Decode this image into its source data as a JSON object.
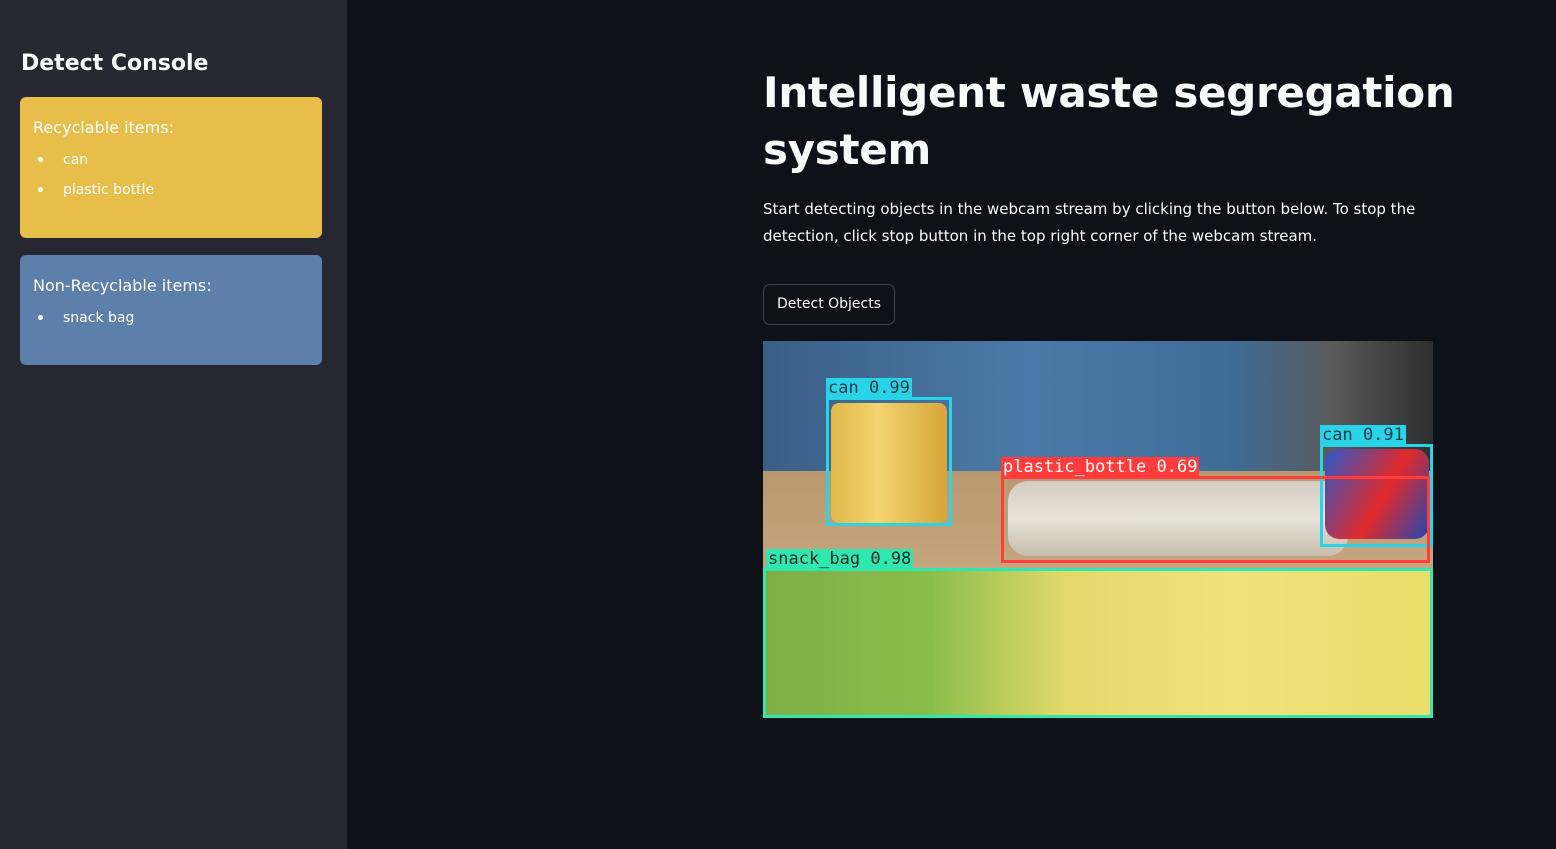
{
  "sidebar": {
    "title": "Detect Console",
    "recyclable": {
      "heading": "Recyclable items:",
      "items": [
        "can",
        "plastic bottle"
      ],
      "color": "#e8be4b"
    },
    "non_recyclable": {
      "heading": "Non-Recyclable items:",
      "items": [
        "snack bag"
      ],
      "color": "#5d7fac"
    }
  },
  "main": {
    "title": "Intelligent waste segregation system",
    "description": "Start detecting objects in the webcam stream by clicking the button below. To stop the detection, click stop button in the top right corner of the webcam stream.",
    "button_label": "Detect Objects"
  },
  "detections": [
    {
      "label": "can 0.99",
      "color": "#2ad4e8"
    },
    {
      "label": "can 0.91",
      "color": "#2ad4e8"
    },
    {
      "label": "plastic_bottle 0.69",
      "color": "#ff3b3b"
    },
    {
      "label": "snack_bag 0.98",
      "color": "#2ee8b0"
    }
  ],
  "colors": {
    "background": "#0e1117",
    "sidebar": "#262730",
    "text": "#fafafa"
  }
}
